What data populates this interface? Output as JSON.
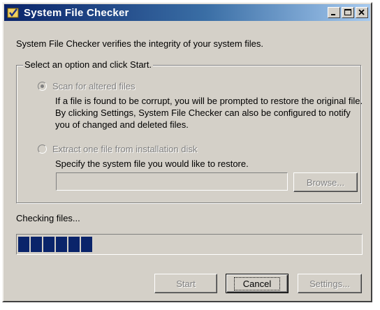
{
  "window": {
    "title": "System File Checker",
    "controls": [
      "minimize-icon",
      "maximize-icon",
      "close-icon"
    ]
  },
  "intro_text": "System File Checker verifies the integrity of your system files.",
  "options_group": {
    "legend": "Select an option and click Start.",
    "scan_option": {
      "label": "Scan for altered files",
      "selected": true,
      "enabled": false,
      "description": "If a file is found to be corrupt, you will be prompted to restore the original file. By clicking Settings, System File Checker can also be configured to notify you of changed and deleted files."
    },
    "extract_option": {
      "label": "Extract one file from installation disk",
      "selected": false,
      "enabled": false,
      "description": "Specify the system file you would like to restore.",
      "file_path_value": "",
      "browse_label": "Browse..."
    }
  },
  "progress": {
    "label": "Checking files...",
    "fraction": 0.24,
    "color": "#0a246a"
  },
  "buttons": {
    "start": "Start",
    "cancel": "Cancel",
    "settings": "Settings..."
  }
}
